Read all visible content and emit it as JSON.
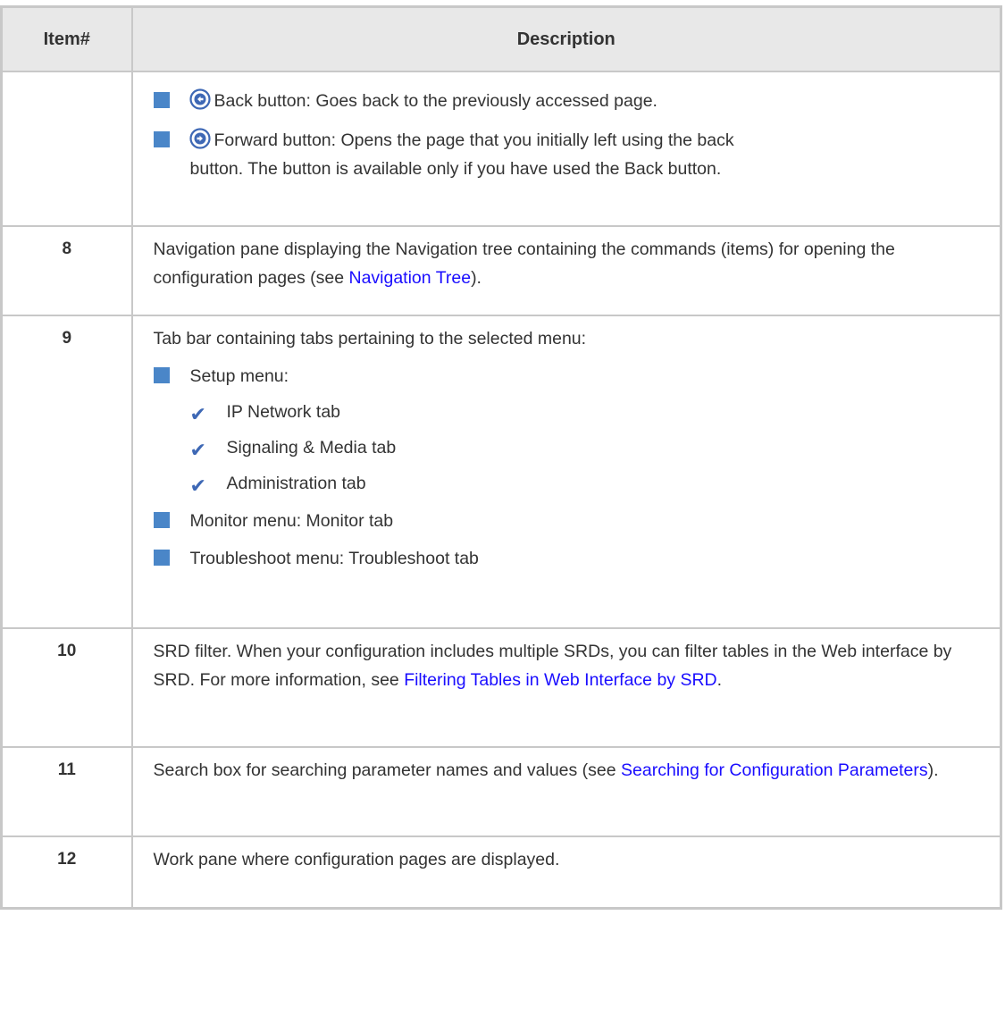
{
  "header": {
    "col1": "Item#",
    "col2": "Description"
  },
  "row_controls": {
    "back": "Back button: Goes back to the previously accessed page.",
    "forward_line1": "Forward button: Opens the page that you initially left using the back",
    "forward_line2": "button. The button is available only if you have used the Back button."
  },
  "row8": {
    "num": "8",
    "text_before": "Navigation pane displaying the Navigation tree containing the commands (items) for opening the configuration pages (see ",
    "link": "Navigation Tree",
    "text_after": ")."
  },
  "row9": {
    "num": "9",
    "intro": "Tab bar containing tabs pertaining to the selected menu:",
    "setup": "Setup menu:",
    "setup_tabs": [
      "IP Network tab",
      "Signaling & Media tab",
      "Administration tab"
    ],
    "monitor": "Monitor menu: Monitor tab",
    "troubleshoot": "Troubleshoot menu: Troubleshoot tab"
  },
  "row10": {
    "num": "10",
    "text_before": "SRD filter. When your configuration includes multiple SRDs, you can filter tables in the Web interface by SRD. For more information, see ",
    "link": "Filtering Tables in Web Interface by SRD",
    "text_after": "."
  },
  "row11": {
    "num": "11",
    "text_before": "Search box for searching parameter names and values (see ",
    "link": "Searching for Configuration Parameters",
    "text_after": ")."
  },
  "row12": {
    "num": "12",
    "text": "Work pane where configuration pages are displayed."
  },
  "colors": {
    "bullet": "#4a86c8",
    "check": "#3e68b5",
    "link": "#1a0dff",
    "border": "#c8c8c8",
    "header_bg": "#e8e8e8"
  },
  "icons": {
    "back": "arrow-left-circle-icon",
    "forward": "arrow-right-circle-icon",
    "bullet": "square-bullet-icon",
    "check": "checkmark-icon"
  }
}
